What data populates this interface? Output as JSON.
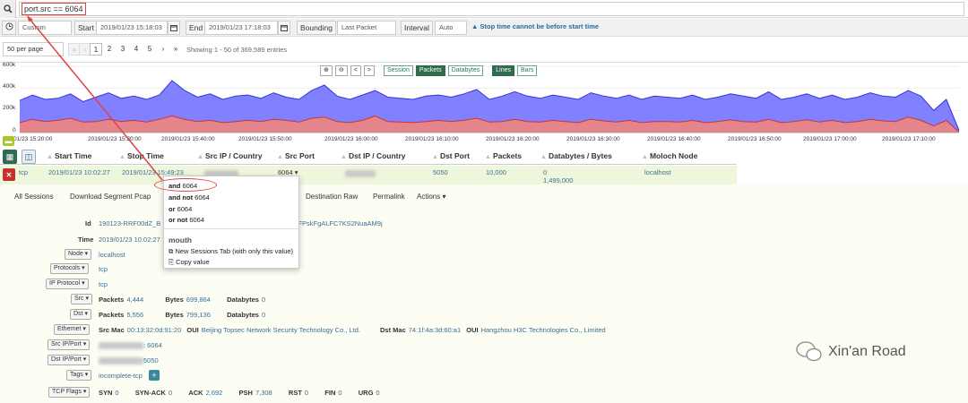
{
  "search": {
    "query": "port.src == 6064"
  },
  "time": {
    "range": "Custom",
    "start_label": "Start",
    "start_value": "2019/01/23 15:18:03",
    "end_label": "End",
    "end_value": "2019/01/23 17:18:03",
    "bounding_label": "Bounding",
    "bounding_value": "Last Packet",
    "interval_label": "Interval",
    "interval_value": "Auto",
    "warning": "Stop time cannot be before start time"
  },
  "paging": {
    "per_page": "50 per page",
    "prev_first": "«",
    "prev": "‹",
    "pages": [
      "1",
      "2",
      "3",
      "4",
      "5"
    ],
    "next": "›",
    "last": "»",
    "showing": "Showing 1 - 50 of 369,589 entries"
  },
  "chart_controls": {
    "zoom_in": "🔍",
    "zoom_out": "🔍",
    "left": "<",
    "right": ">",
    "session": "Session",
    "packets": "Packets",
    "databytes": "Databytes",
    "lines": "Lines",
    "bars": "Bars"
  },
  "chart_data": {
    "type": "area",
    "y_ticks": [
      "600k",
      "400k",
      "200k",
      "0"
    ],
    "ylim": [
      0,
      600000
    ],
    "x_ticks": [
      "19/01/23 15:20:00",
      "2019/01/23 15:30:00",
      "2019/01/23 15:40:00",
      "2019/01/23 15:50:00",
      "2019/01/23 16:00:00",
      "2019/01/23 16:10:00",
      "2019/01/23 16:20:00",
      "2019/01/23 16:30:00",
      "2019/01/23 16:40:00",
      "2019/01/23 16:50:00",
      "2019/01/23 17:00:00",
      "2019/01/23 17:10:00"
    ],
    "series": [
      {
        "color": "#6b6bff",
        "values": [
          290000,
          340000,
          300000,
          310000,
          350000,
          280000,
          320000,
          360000,
          310000,
          330000,
          300000,
          340000,
          470000,
          380000,
          320000,
          350000,
          300000,
          330000,
          340000,
          310000,
          360000,
          320000,
          300000,
          380000,
          430000,
          330000,
          300000,
          340000,
          380000,
          320000,
          310000,
          300000,
          330000,
          340000,
          320000,
          350000,
          390000,
          300000,
          330000,
          370000,
          330000,
          310000,
          340000,
          320000,
          300000,
          360000,
          330000,
          310000,
          340000,
          300000,
          330000,
          320000,
          310000,
          340000,
          300000,
          320000,
          350000,
          330000,
          310000,
          370000,
          300000,
          320000,
          350000,
          310000,
          340000,
          300000,
          320000,
          360000,
          330000,
          320000,
          380000,
          330000,
          200000,
          300000,
          20000
        ]
      },
      {
        "color": "#e98585",
        "values": [
          90000,
          120000,
          100000,
          110000,
          130000,
          95000,
          100000,
          120000,
          100000,
          110000,
          95000,
          120000,
          150000,
          120000,
          100000,
          110000,
          90000,
          100000,
          110000,
          100000,
          120000,
          110000,
          95000,
          130000,
          140000,
          100000,
          90000,
          110000,
          150000,
          100000,
          95000,
          90000,
          100000,
          110000,
          100000,
          110000,
          130000,
          95000,
          100000,
          120000,
          100000,
          95000,
          110000,
          100000,
          90000,
          120000,
          105000,
          95000,
          110000,
          90000,
          100000,
          100000,
          95000,
          110000,
          90000,
          100000,
          115000,
          100000,
          95000,
          120000,
          90000,
          100000,
          115000,
          95000,
          110000,
          90000,
          100000,
          120000,
          105000,
          100000,
          140000,
          110000,
          60000,
          110000,
          5000
        ]
      }
    ]
  },
  "table": {
    "columns": [
      "Start Time",
      "Stop Time",
      "Src IP / Country",
      "Src Port",
      "Dst IP / Country",
      "Dst Port",
      "Packets",
      "Databytes / Bytes",
      "Moloch Node"
    ],
    "row": {
      "protocol": "tcp",
      "start": "2019/01/23 10:02:27",
      "stop": "2019/01/23 15:49:23",
      "src_ip": "",
      "src_port": "6064",
      "dst_ip": "",
      "dst_port": "5050",
      "packets": "10,000",
      "databytes": "0",
      "bytes": "1,499,000",
      "node": "localhost"
    }
  },
  "detail_tabs": [
    "All Sessions",
    "Download Segment Pcap",
    "Destination Raw",
    "Permalink",
    "Actions"
  ],
  "context_menu": {
    "items": [
      {
        "op": "and",
        "value": "6064"
      },
      {
        "op": "and not",
        "value": "6064"
      },
      {
        "op": "or",
        "value": "6064"
      },
      {
        "op": "or not",
        "value": "6064"
      }
    ],
    "heading": "mouth",
    "new_tab": "New Sessions Tab (with only this value)",
    "copy": "Copy value"
  },
  "detail": {
    "id_label": "Id",
    "id_value": "190123-RRF00dZ_B",
    "id_suffix": "RFPskFgALFC7KS2NuaAM9j",
    "time_label": "Time",
    "time_value": "2019/01/23 10:02:27",
    "node_label": "Node",
    "node_value": "localhost",
    "protocols_label": "Protocols",
    "protocols_value": "tcp",
    "ipproto_label": "IP Protocol",
    "ipproto_value": "tcp",
    "src_label": "Src",
    "src_packets_key": "Packets",
    "src_packets": "4,444",
    "src_bytes_key": "Bytes",
    "src_bytes": "699,864",
    "src_databytes_key": "Databytes",
    "src_databytes": "0",
    "dst_label": "Dst",
    "dst_packets_key": "Packets",
    "dst_packets": "5,556",
    "dst_bytes_key": "Bytes",
    "dst_bytes": "799,136",
    "dst_databytes_key": "Databytes",
    "dst_databytes": "0",
    "ethernet_label": "Ethernet",
    "src_mac_key": "Src Mac",
    "src_mac": "00:13:32:0d:91:20",
    "oui_key": "OUI",
    "src_oui": "Beijing Topsec Network Security Technology Co., Ltd.",
    "dst_mac_key": "Dst Mac",
    "dst_mac": "74:1f:4a:3d:60:a1",
    "dst_oui": "Hangzhou H3C Technologies Co., Limited",
    "srcipport_label": "Src IP/Port",
    "srcipport_value": ": 6064",
    "dstipport_label": "Dst IP/Port",
    "dstipport_value": "5050",
    "tags_label": "Tags",
    "tags_value": "incomplete-tcp",
    "tcpflags_label": "TCP Flags",
    "flags": [
      {
        "k": "SYN",
        "v": "0"
      },
      {
        "k": "SYN-ACK",
        "v": "0"
      },
      {
        "k": "ACK",
        "v": "2,692"
      },
      {
        "k": "PSH",
        "v": "7,308"
      },
      {
        "k": "RST",
        "v": "0"
      },
      {
        "k": "FIN",
        "v": "0"
      },
      {
        "k": "URG",
        "v": "0"
      }
    ]
  },
  "watermark": {
    "text": "Xin'an Road"
  },
  "colors": {
    "accent": "#2e6b4f",
    "highlight": "#d94545",
    "link": "#3a6f98",
    "row_bg": "#eef7dc"
  }
}
